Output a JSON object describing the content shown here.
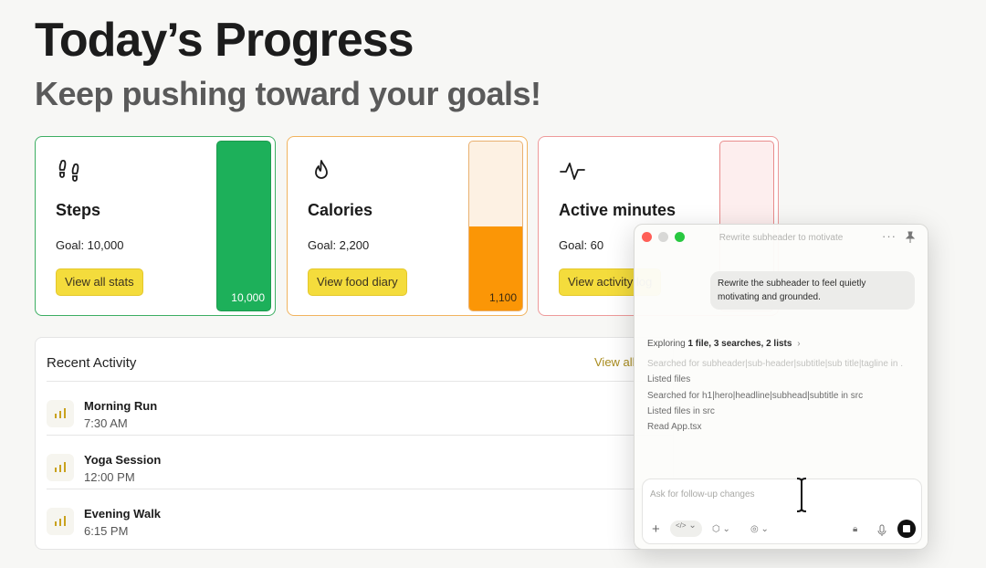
{
  "header": {
    "title": "Today’s Progress",
    "subtitle": "Keep pushing toward your goals!"
  },
  "cards": [
    {
      "name": "Steps",
      "goal": "Goal: 10,000",
      "button": "View all stats",
      "value_label": "10,000",
      "progress": 1.0,
      "icon": "footprints-icon",
      "accent": "#1db05a"
    },
    {
      "name": "Calories",
      "goal": "Goal: 2,200",
      "button": "View food diary",
      "value_label": "1,100",
      "progress": 0.5,
      "icon": "flame-icon",
      "accent": "#fb9606"
    },
    {
      "name": "Active minutes",
      "goal": "Goal: 60",
      "button": "View activity log",
      "value_label": "",
      "progress": 0,
      "icon": "activity-icon",
      "accent": "#f08a8a"
    }
  ],
  "recent": {
    "title": "Recent Activity",
    "view_all": "View all",
    "items": [
      {
        "name": "Morning Run",
        "time": "7:30 AM",
        "icon": "bar-chart-icon"
      },
      {
        "name": "Yoga Session",
        "time": "12:00 PM",
        "icon": "bar-chart-icon"
      },
      {
        "name": "Evening Walk",
        "time": "6:15 PM",
        "icon": "bar-chart-icon"
      }
    ]
  },
  "assistant": {
    "window_title": "Rewrite subheader to motivate",
    "message": "Rewrite the subheader to feel quietly motivating and grounded.",
    "exploring_prefix": "Exploring ",
    "exploring_summary": "1 file, 3 searches, 2 lists",
    "log": [
      "Searched for subheader|sub-header|subtitle|sub title|tagline in .",
      "Listed files",
      "Searched for h1|hero|headline|subhead|subtitle in src",
      "Listed files in src",
      "Read App.tsx"
    ],
    "input_placeholder": "Ask for follow-up changes",
    "toolbar": {
      "add": "+",
      "code": "</>"
    }
  }
}
